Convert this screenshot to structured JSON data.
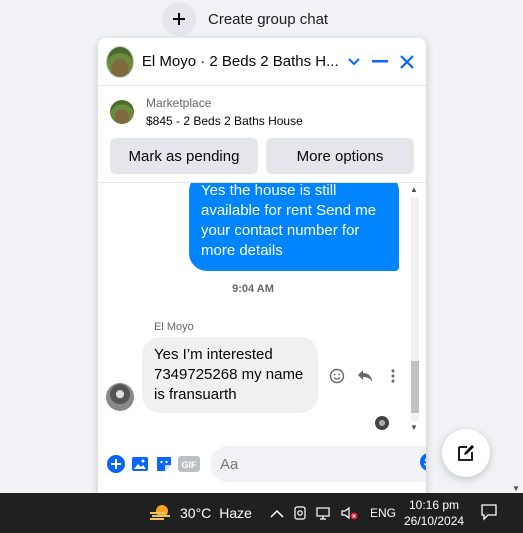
{
  "top": {
    "create_group_label": "Create group chat"
  },
  "chat": {
    "title": "El Moyo · 2 Beds 2 Baths H...",
    "marketplace": {
      "source": "Marketplace",
      "listing": "$845 - 2 Beds 2 Baths House",
      "buttons": [
        "Mark as pending",
        "More options"
      ]
    },
    "messages": {
      "outgoing_text": "Yes the house is still available for rent Send me your contact number for more details",
      "timestamp": "9:04 AM",
      "sender_name": "El Moyo",
      "incoming_text": "Yes I’m interested 7349725268 my name is fransuarth"
    },
    "composer": {
      "placeholder": "Aa"
    }
  },
  "taskbar": {
    "weather_temp": "30°C",
    "weather_desc": "Haze",
    "language": "ENG",
    "time": "10:16 pm",
    "date": "26/10/2024"
  },
  "colors": {
    "accent": "#0084ff",
    "header_icon": "#0866ff"
  }
}
